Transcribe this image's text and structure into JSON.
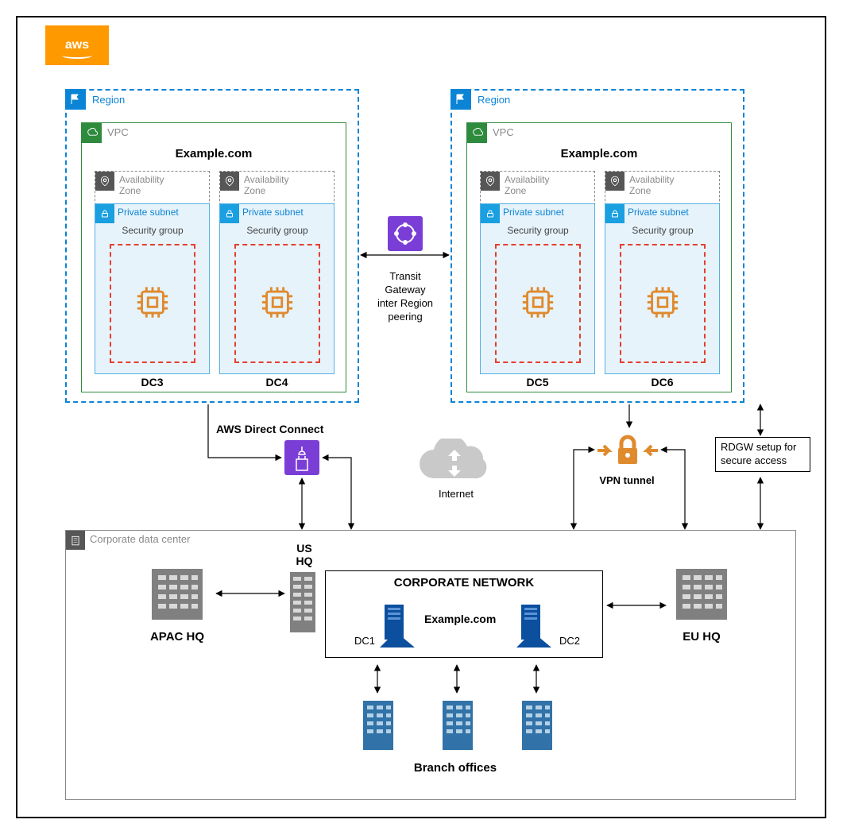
{
  "aws": {
    "badge": "aws"
  },
  "regions": [
    {
      "label": "Region",
      "domain": "Example.com",
      "azs": [
        {
          "label": "Availability Zone",
          "subnet": "Private subnet",
          "sg": "Security group",
          "dc": "DC3"
        },
        {
          "label": "Availability Zone",
          "subnet": "Private subnet",
          "sg": "Security group",
          "dc": "DC4"
        }
      ],
      "vpc_label": "VPC"
    },
    {
      "label": "Region",
      "domain": "Example.com",
      "azs": [
        {
          "label": "Availability Zone",
          "subnet": "Private subnet",
          "sg": "Security group",
          "dc": "DC5"
        },
        {
          "label": "Availability Zone",
          "subnet": "Private subnet",
          "sg": "Security group",
          "dc": "DC6"
        }
      ],
      "vpc_label": "VPC"
    }
  ],
  "tgw": {
    "label": "Transit Gateway inter Region peering"
  },
  "direct_connect": {
    "label": "AWS Direct Connect"
  },
  "internet": {
    "label": "Internet"
  },
  "vpn": {
    "label": "VPN tunnel"
  },
  "rdgw": {
    "text": "RDGW setup for secure access"
  },
  "cdc": {
    "label": "Corporate data center"
  },
  "hq": {
    "apac": "APAC HQ",
    "us": "US HQ",
    "eu": "EU HQ"
  },
  "corpnet": {
    "title": "CORPORATE NETWORK",
    "domain": "Example.com",
    "dc1": "DC1",
    "dc2": "DC2"
  },
  "branch": {
    "label": "Branch offices"
  }
}
